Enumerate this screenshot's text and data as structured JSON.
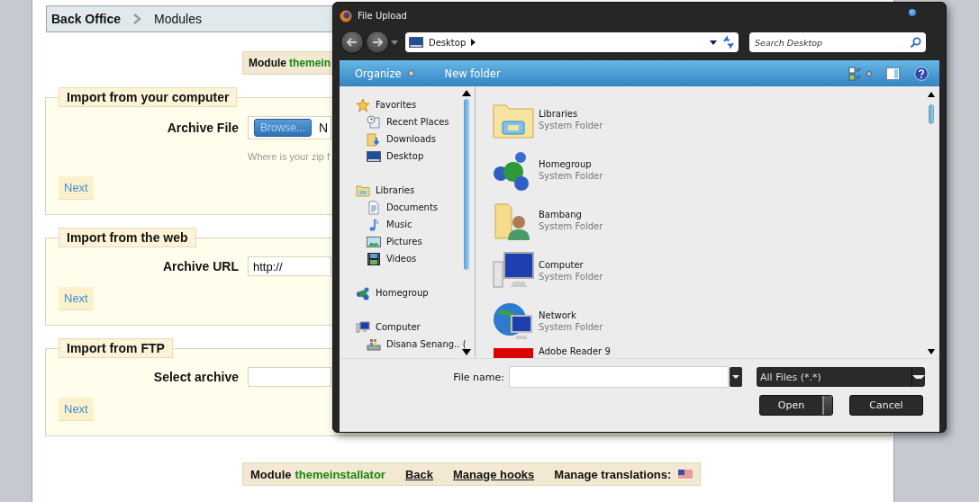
{
  "breadcrumb": [
    {
      "label": "Back Office",
      "kind": "root"
    },
    {
      "label": "Modules",
      "kind": "page"
    }
  ],
  "module_banner": {
    "label": "Module",
    "module_name": "themein"
  },
  "sections": [
    {
      "title": "Import from your computer",
      "kind": "file",
      "field_label": "Archive File",
      "browse_button": "Browse...",
      "file_status": "N",
      "hint": "Where is your zip f",
      "next_button": "Next"
    },
    {
      "title": "Import from the web",
      "kind": "text",
      "field_label": "Archive URL",
      "value": "http://",
      "next_button": "Next"
    },
    {
      "title": "Import from FTP",
      "kind": "select",
      "field_label": "Select archive",
      "next_button": "Next"
    }
  ],
  "footer_bar": {
    "label": "Module",
    "module_name": "themeinstallator",
    "links": [
      "Back",
      "Manage hooks"
    ],
    "translations_label": "Manage translations:"
  },
  "dialog": {
    "title": "File Upload",
    "address": "Desktop",
    "search": {
      "placeholder": "Search Desktop"
    },
    "toolbar": [
      {
        "label": "Organize",
        "has_menu": true
      },
      {
        "label": "New folder",
        "has_menu": false
      }
    ],
    "nav_tree": [
      {
        "label": "Favorites",
        "kind": "star",
        "children": [
          {
            "label": "Recent Places",
            "kind": "recent"
          },
          {
            "label": "Downloads",
            "kind": "downloads"
          },
          {
            "label": "Desktop",
            "kind": "desktop"
          }
        ]
      },
      {
        "label": "Libraries",
        "kind": "library",
        "children": [
          {
            "label": "Documents",
            "kind": "document"
          },
          {
            "label": "Music",
            "kind": "music"
          },
          {
            "label": "Pictures",
            "kind": "picture"
          },
          {
            "label": "Videos",
            "kind": "video"
          }
        ]
      },
      {
        "label": "Homegroup",
        "kind": "homegroup"
      },
      {
        "label": "Computer",
        "kind": "computer",
        "children": [
          {
            "label": "Disana Senang.. (",
            "kind": "drive"
          }
        ]
      }
    ],
    "items": [
      {
        "name": "Libraries",
        "type": "System Folder",
        "kind": "libraries"
      },
      {
        "name": "Homegroup",
        "type": "System Folder",
        "kind": "homegroup"
      },
      {
        "name": "Bambang",
        "type": "System Folder",
        "kind": "user"
      },
      {
        "name": "Computer",
        "type": "System Folder",
        "kind": "computer"
      },
      {
        "name": "Network",
        "type": "System Folder",
        "kind": "network"
      },
      {
        "name": "Adobe Reader 9",
        "kind": "pdf"
      }
    ],
    "file_name_label": "File name:",
    "file_type": "All Files (*.*)",
    "buttons": [
      {
        "label": "Open",
        "kind": "split"
      },
      {
        "label": "Cancel",
        "kind": "plain"
      }
    ]
  }
}
